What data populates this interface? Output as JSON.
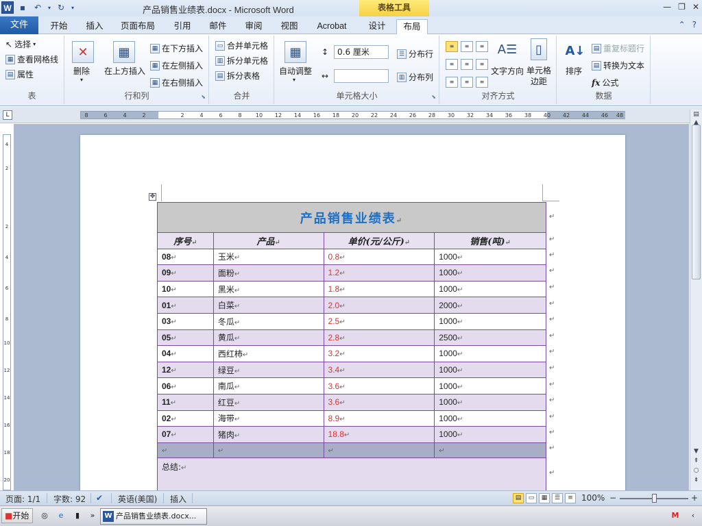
{
  "titlebar": {
    "title": "产品销售业绩表.docx - Microsoft Word",
    "contextual_tab_group": "表格工具",
    "app_icon_label": "W",
    "window_controls": {
      "minimize": "—",
      "restore": "❐",
      "close": "✕"
    }
  },
  "tabs": {
    "file": "文件",
    "items": [
      "开始",
      "插入",
      "页面布局",
      "引用",
      "邮件",
      "审阅",
      "视图",
      "Acrobat",
      "设计",
      "布局"
    ],
    "active": "布局"
  },
  "ribbon": {
    "groups": {
      "table": {
        "label": "表",
        "select": "选择",
        "view_gridlines": "查看网格线",
        "properties": "属性"
      },
      "rows_cols": {
        "label": "行和列",
        "delete": "删除",
        "insert_above": "在上方插入",
        "insert_below": "在下方插入",
        "insert_left": "在左侧插入",
        "insert_right": "在右侧插入"
      },
      "merge": {
        "label": "合并",
        "merge_cells": "合并单元格",
        "split_cells": "拆分单元格",
        "split_table": "拆分表格"
      },
      "cell_size": {
        "label": "单元格大小",
        "autofit": "自动调整",
        "height_value": "0.6 厘米",
        "width_value": "",
        "distribute_rows": "分布行",
        "distribute_cols": "分布列"
      },
      "alignment": {
        "label": "对齐方式",
        "text_direction": "文字方向",
        "cell_margins": "单元格\n边距"
      },
      "data": {
        "label": "数据",
        "sort": "排序",
        "repeat_header": "重复标题行",
        "convert_to_text": "转换为文本",
        "formula": "公式"
      }
    }
  },
  "ruler": {
    "ticks": [
      "8",
      "6",
      "4",
      "2",
      "2",
      "4",
      "6",
      "8",
      "10",
      "12",
      "14",
      "16",
      "18",
      "20",
      "22",
      "24",
      "26",
      "28",
      "30",
      "32",
      "34",
      "36",
      "38",
      "40",
      "42",
      "44",
      "46",
      "48"
    ],
    "vticks": [
      "4",
      "2",
      "2",
      "4",
      "6",
      "8",
      "10",
      "12",
      "14",
      "16",
      "18",
      "20"
    ]
  },
  "table": {
    "title": "产品销售业绩表",
    "headers": [
      "序号",
      "产品",
      "单价(元/公斤)",
      "销售(吨)"
    ],
    "rows": [
      {
        "id": "08",
        "product": "玉米",
        "price": "0.8",
        "sales": "1000"
      },
      {
        "id": "09",
        "product": "面粉",
        "price": "1.2",
        "sales": "1000"
      },
      {
        "id": "10",
        "product": "黑米",
        "price": "1.8",
        "sales": "1000"
      },
      {
        "id": "01",
        "product": "白菜",
        "price": "2.0",
        "sales": "2000"
      },
      {
        "id": "03",
        "product": "冬瓜",
        "price": "2.5",
        "sales": "1000"
      },
      {
        "id": "05",
        "product": "黄瓜",
        "price": "2.8",
        "sales": "2500"
      },
      {
        "id": "04",
        "product": "西红柿",
        "price": "3.2",
        "sales": "1000"
      },
      {
        "id": "12",
        "product": "绿豆",
        "price": "3.4",
        "sales": "1000"
      },
      {
        "id": "06",
        "product": "南瓜",
        "price": "3.6",
        "sales": "1000"
      },
      {
        "id": "11",
        "product": "红豆",
        "price": "3.6",
        "sales": "1000"
      },
      {
        "id": "02",
        "product": "海带",
        "price": "8.9",
        "sales": "1000"
      },
      {
        "id": "07",
        "product": "猪肉",
        "price": "18.8",
        "sales": "1000"
      }
    ],
    "summary_label": "总结:",
    "paragraph_mark": "↵",
    "colors": {
      "title": "#1f6fc4",
      "price": "#e0302a",
      "border": "#7a4aa3",
      "band": "#e4dcee"
    }
  },
  "statusbar": {
    "page": "页面: 1/1",
    "word_count": "字数: 92",
    "language": "英语(美国)",
    "mode": "插入",
    "zoom": "100%",
    "zoom_minus": "−",
    "zoom_plus": "+"
  },
  "taskbar": {
    "start": "开始",
    "app_button": "产品销售业绩表.docx...",
    "more": "»"
  }
}
